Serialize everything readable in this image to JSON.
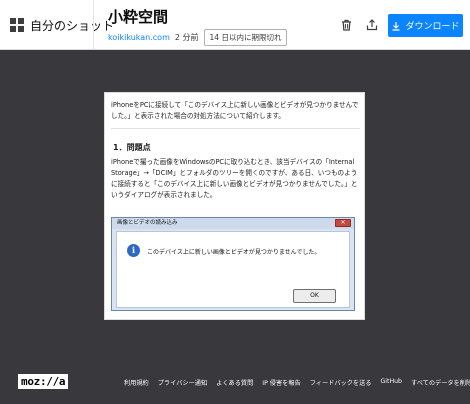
{
  "header": {
    "my_shots_label": "自分のショット",
    "title": "小粋空間",
    "site": "koikikukan.com",
    "time_ago": "2 分前",
    "expire_text": "14 日以内に期限切れ",
    "download_label": "ダウンロード"
  },
  "shot": {
    "intro": "iPhoneをPCに接続して「このデバイス上に新しい画像とビデオが見つかりませんでした。」と表示された場合の対処方法について紹介します。",
    "heading": "1．問題点",
    "body": "iPhoneで撮った画像をWindowsのPCに取り込むとき、該当デバイスの「Internal Storage」→「DCIM」とフォルダのツリーを開くのですが、ある日、いつものように接続すると「このデバイス上に新しい画像とビデオが見つかりませんでした。」というダイアログが表示されました。",
    "dialog": {
      "title": "画像とビデオの読み込み",
      "message": "このデバイス上に新しい画像とビデオが見つかりませんでした。",
      "ok_label": "OK"
    }
  },
  "footer": {
    "logo": "moz://a",
    "links": [
      "利用規約",
      "プライバシー通知",
      "よくある質問",
      "IP 侵害を報告",
      "フィードバックを送る",
      "GitHub",
      "すべてのデータを削除"
    ]
  },
  "colors": {
    "accent": "#0a84ff",
    "background": "#38383d"
  }
}
